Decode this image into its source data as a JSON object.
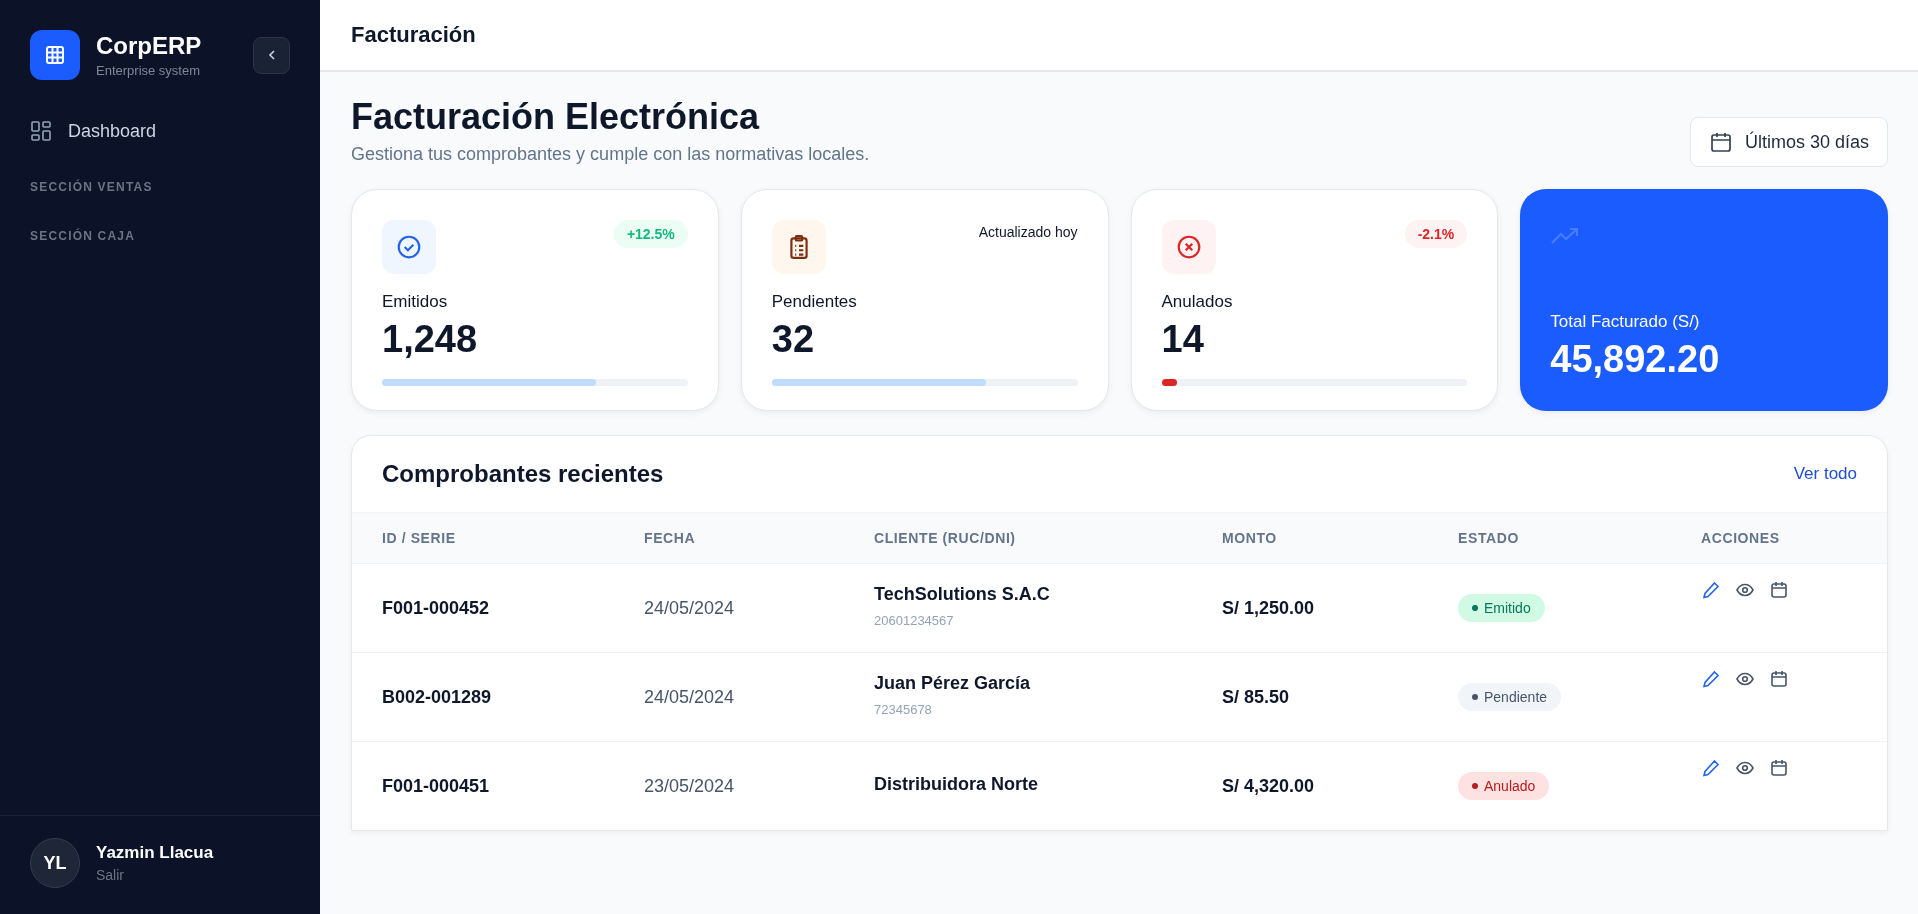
{
  "sidebar": {
    "brand": {
      "name": "CorpERP",
      "subtitle": "Enterprise system"
    },
    "items": [
      {
        "label": "Dashboard",
        "selected": false
      }
    ],
    "sections": [
      "SECCIÓN VENTAS",
      "SECCIÓN CAJA"
    ],
    "user": {
      "initials": "YL",
      "name": "Yazmin Llacua",
      "action": "Salir"
    }
  },
  "header": {
    "title": "Facturación"
  },
  "page": {
    "title": "Facturación Electrónica",
    "subtitle": "Gestiona tus comprobantes y cumple con las normativas locales.",
    "date_range": "Últimos 30 días"
  },
  "cards": [
    {
      "kind": "success",
      "label": "Emitidos",
      "value": "1,248",
      "badge": "+12.5%",
      "level": 0.7
    },
    {
      "kind": "pending",
      "label": "Pendientes",
      "value": "32",
      "badge": "Actualizado hoy",
      "level": 0.7
    },
    {
      "kind": "void",
      "label": "Anulados",
      "value": "14",
      "badge": "-2.1%",
      "level": 0.05
    },
    {
      "kind": "total",
      "label": "Total Facturado (S/)",
      "value": "45,892.20"
    }
  ],
  "table": {
    "title": "Comprobantes recientes",
    "link": "Ver todo",
    "columns": [
      "ID / SERIE",
      "FECHA",
      "CLIENTE (RUC/DNI)",
      "MONTO",
      "ESTADO",
      "ACCIONES"
    ],
    "rows": [
      {
        "id": "F001-000452",
        "date": "24/05/2024",
        "client": "TechSolutions S.A.C",
        "doc": "20601234567",
        "amount": "S/ 1,250.00",
        "status": "Emitido",
        "kind": "issued"
      },
      {
        "id": "B002-001289",
        "date": "24/05/2024",
        "client": "Juan Pérez García",
        "doc": "72345678",
        "amount": "S/ 85.50",
        "status": "Pendiente",
        "kind": "pending"
      },
      {
        "id": "F001-000451",
        "date": "23/05/2024",
        "client": "Distribuidora Norte",
        "amount": "S/ 4,320.00",
        "status": "Anulado",
        "kind": "void"
      }
    ]
  }
}
